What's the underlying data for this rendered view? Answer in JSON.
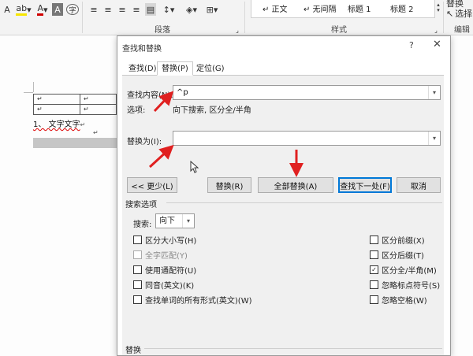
{
  "ribbon": {
    "group_paragraph": "段落",
    "group_styles": "样式",
    "group_edit": "编辑",
    "styles": [
      "↵ 正文",
      "↵ 无间隔",
      "标题 1",
      "标题 2"
    ],
    "replace_btn": "替换",
    "select_btn": "选择"
  },
  "document": {
    "cell_mark": "↵",
    "list_text": "1、 文字文字",
    "para_mark": "↵"
  },
  "dialog": {
    "title": "查找和替换",
    "help": "?",
    "close": "✕",
    "tabs": [
      "查找(D)",
      "替换(P)",
      "定位(G)"
    ],
    "find_label": "查找内容(N):",
    "find_value": "^p",
    "options_label": "选项:",
    "options_value": "向下搜索, 区分全/半角",
    "replace_label": "替换为(I):",
    "replace_value": "",
    "buttons": {
      "less": "<< 更少(L)",
      "replace": "替换(R)",
      "replace_all": "全部替换(A)",
      "find_next": "查找下一处(F)",
      "cancel": "取消"
    },
    "search_options_title": "搜索选项",
    "search_label": "搜索:",
    "search_value": "向下",
    "left_options": [
      {
        "label": "区分大小写(H)",
        "checked": false,
        "disabled": false
      },
      {
        "label": "全字匹配(Y)",
        "checked": false,
        "disabled": true
      },
      {
        "label": "使用通配符(U)",
        "checked": false,
        "disabled": false
      },
      {
        "label": "同音(英文)(K)",
        "checked": false,
        "disabled": false
      },
      {
        "label": "查找单词的所有形式(英文)(W)",
        "checked": false,
        "disabled": false
      }
    ],
    "right_options": [
      {
        "label": "区分前缀(X)",
        "checked": false
      },
      {
        "label": "区分后缀(T)",
        "checked": false
      },
      {
        "label": "区分全/半角(M)",
        "checked": true
      },
      {
        "label": "忽略标点符号(S)",
        "checked": false
      },
      {
        "label": "忽略空格(W)",
        "checked": false
      }
    ],
    "replace_section_title": "替换"
  },
  "colors": {
    "accent": "#0078d7",
    "arrow": "#e02020"
  }
}
